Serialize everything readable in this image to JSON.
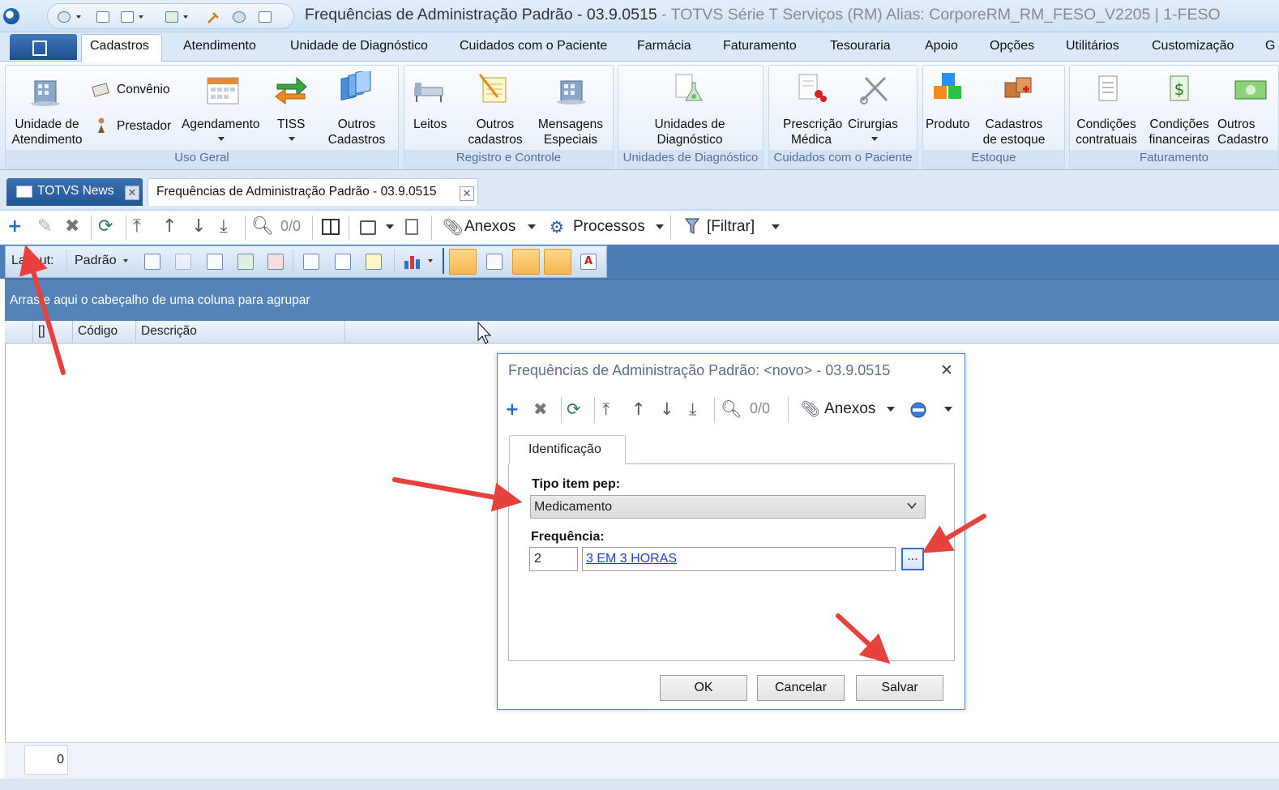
{
  "window": {
    "title": "Frequências de Administração Padrão - 03.9.0515",
    "title_suffix": " - TOTVS Série T Serviços (RM) Alias: CorporeRM_RM_FESO_V2205 | 1-FESO"
  },
  "menu": {
    "tabs": [
      "Cadastros",
      "Atendimento",
      "Unidade de Diagnóstico",
      "Cuidados com o Paciente",
      "Farmácia",
      "Faturamento",
      "Tesouraria",
      "Apoio",
      "Opções",
      "Utilitários",
      "Customização",
      "G"
    ]
  },
  "ribbon": {
    "uso_geral": {
      "label": "Uso Geral",
      "unidade": "Unidade de\nAtendimento",
      "convenio": "Convênio",
      "prestador": "Prestador",
      "agendamento": "Agendamento",
      "tiss": "TISS",
      "outros": "Outros\nCadastros"
    },
    "registro": {
      "label": "Registro e Controle",
      "leitos": "Leitos",
      "outros": "Outros\ncadastros",
      "mensagens": "Mensagens\nEspeciais"
    },
    "diagnostico": {
      "label": "Unidades de Diagnóstico",
      "unidades": "Unidades de\nDiagnóstico"
    },
    "cuidados": {
      "label": "Cuidados com o Paciente",
      "prescricao": "Prescrição\nMédica",
      "cirurgias": "Cirurgias"
    },
    "estoque": {
      "label": "Estoque",
      "produto": "Produto",
      "cadastros": "Cadastros\nde estoque"
    },
    "faturamento": {
      "label": "Faturamento",
      "condicoes_contratuais": "Condições\ncontratuais",
      "condicoes_financeiras": "Condições\nfinanceiras",
      "outros": "Outros\nCadastro"
    }
  },
  "doc_tabs": {
    "news": "TOTVS News",
    "current": "Frequências de Administração Padrão - 03.9.0515"
  },
  "toolbar": {
    "record_counter": "0/0",
    "anexos": "Anexos",
    "processos": "Processos",
    "filtrar": "[Filtrar]"
  },
  "layout_bar": {
    "label": "Layout:",
    "layout_value": "Padrão"
  },
  "grid": {
    "group_hint": "Arraste aqui o cabeçalho de uma coluna para agrupar",
    "columns": [
      "[]",
      "Código",
      "Descrição"
    ],
    "record_count": "0"
  },
  "dialog": {
    "title": "Frequências de Administração Padrão: <novo> - 03.9.0515",
    "record_counter": "0/0",
    "anexos": "Anexos",
    "tab": "Identificação",
    "tipo_label": "Tipo item pep:",
    "tipo_value": "Medicamento",
    "freq_label": "Frequência:",
    "freq_code": "2",
    "freq_desc": "3 EM 3 HORAS",
    "lookup": "...",
    "ok": "OK",
    "cancel": "Cancelar",
    "save": "Salvar"
  }
}
